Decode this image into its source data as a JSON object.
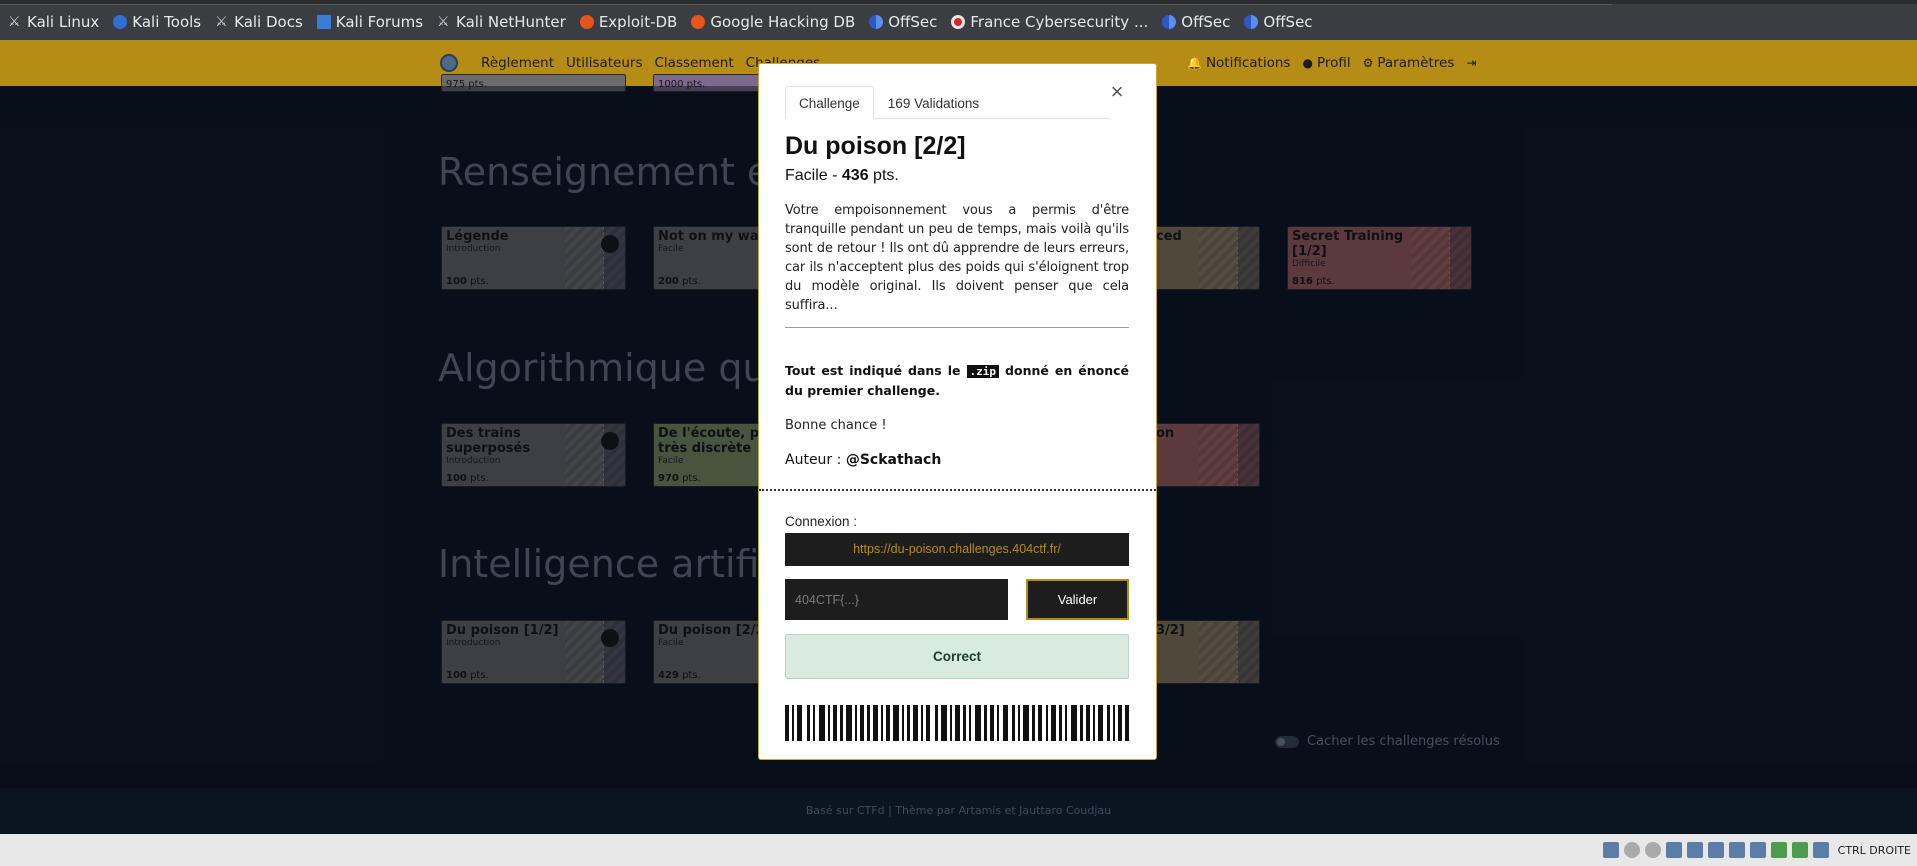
{
  "bookmarks": [
    {
      "label": "Kali Linux",
      "icon": "kali-dragon-icon"
    },
    {
      "label": "Kali Tools",
      "icon": "kali-tools-icon"
    },
    {
      "label": "Kali Docs",
      "icon": "kali-dragon-icon"
    },
    {
      "label": "Kali Forums",
      "icon": "kali-forums-icon"
    },
    {
      "label": "Kali NetHunter",
      "icon": "kali-dragon-icon"
    },
    {
      "label": "Exploit-DB",
      "icon": "exploit-db-icon"
    },
    {
      "label": "Google Hacking DB",
      "icon": "exploit-db-icon"
    },
    {
      "label": "OffSec",
      "icon": "offsec-icon"
    },
    {
      "label": "France Cybersecurity ...",
      "icon": "france-cybersecurity-icon"
    },
    {
      "label": "OffSec",
      "icon": "offsec-icon"
    },
    {
      "label": "OffSec",
      "icon": "offsec-icon"
    }
  ],
  "navbar": {
    "links": [
      "Règlement",
      "Utilisateurs",
      "Classement",
      "Challenges"
    ],
    "notifications": "Notifications",
    "profile": "Profil",
    "settings": "Paramètres"
  },
  "sections": [
    {
      "title": "Renseignement en"
    },
    {
      "title": "Algorithmique qua"
    },
    {
      "title": "Intelligence artific"
    }
  ],
  "top_cards": [
    {
      "points": "975 pts."
    },
    {
      "points": "1000 pts."
    }
  ],
  "cards": [
    {
      "title": "Légende",
      "difficulty": "Introduction",
      "points": "100",
      "unit": "pts."
    },
    {
      "title": "Not on my watc",
      "difficulty": "Facile",
      "points": "200",
      "unit": "pts."
    },
    {
      "title": "ced",
      "difficulty": "",
      "points": "",
      "unit": ""
    },
    {
      "title": "Secret Training [1/2]",
      "difficulty": "Difficile",
      "points": "816",
      "unit": "pts."
    },
    {
      "title": "Des trains superposés",
      "difficulty": "Introduction",
      "points": "100",
      "unit": "pts."
    },
    {
      "title": "De l'écoute, pas très discrète",
      "difficulty": "Facile",
      "points": "970",
      "unit": "pts."
    },
    {
      "title": "on",
      "difficulty": "",
      "points": "",
      "unit": ""
    },
    {
      "title": "Du poison [1/2]",
      "difficulty": "Introduction",
      "points": "100",
      "unit": "pts."
    },
    {
      "title": "Du poison [2/2]",
      "difficulty": "Facile",
      "points": "429",
      "unit": "pts."
    },
    {
      "title": "3/2]",
      "difficulty": "",
      "points": "",
      "unit": ""
    }
  ],
  "toggle": {
    "label": "Cacher les challenges résolus"
  },
  "footer": {
    "text": "Basé sur CTFd | Thème par Artamis et Jauttaro Coudjau"
  },
  "tray": {
    "label": "CTRL DROITE"
  },
  "modal": {
    "tabs": [
      "Challenge",
      "169 Validations"
    ],
    "close": "×",
    "title": "Du poison [2/2]",
    "difficulty": "Facile",
    "separator": " - ",
    "points": "436",
    "points_unit": " pts.",
    "description": "Votre empoisonnement vous a permis d'être tranquille pendant un peu de temps, mais voilà qu'ils sont de retour ! Ils ont dû apprendre de leurs erreurs, car ils n'acceptent plus des poids qui s'éloignent trop du modèle original. Ils doivent penser que cela suffira...",
    "hint_before": "Tout est indiqué dans le ",
    "hint_code": ".zip",
    "hint_after": " donné en énoncé du premier challenge.",
    "luck": "Bonne chance !",
    "author_label": "Auteur : ",
    "author": "@Sckathach",
    "connection_label": "Connexion :",
    "connection_url": "https://du-poison.challenges.404ctf.fr/",
    "flag_placeholder": "404CTF{...}",
    "flag_value": "",
    "validate": "Valider",
    "result": "Correct"
  }
}
